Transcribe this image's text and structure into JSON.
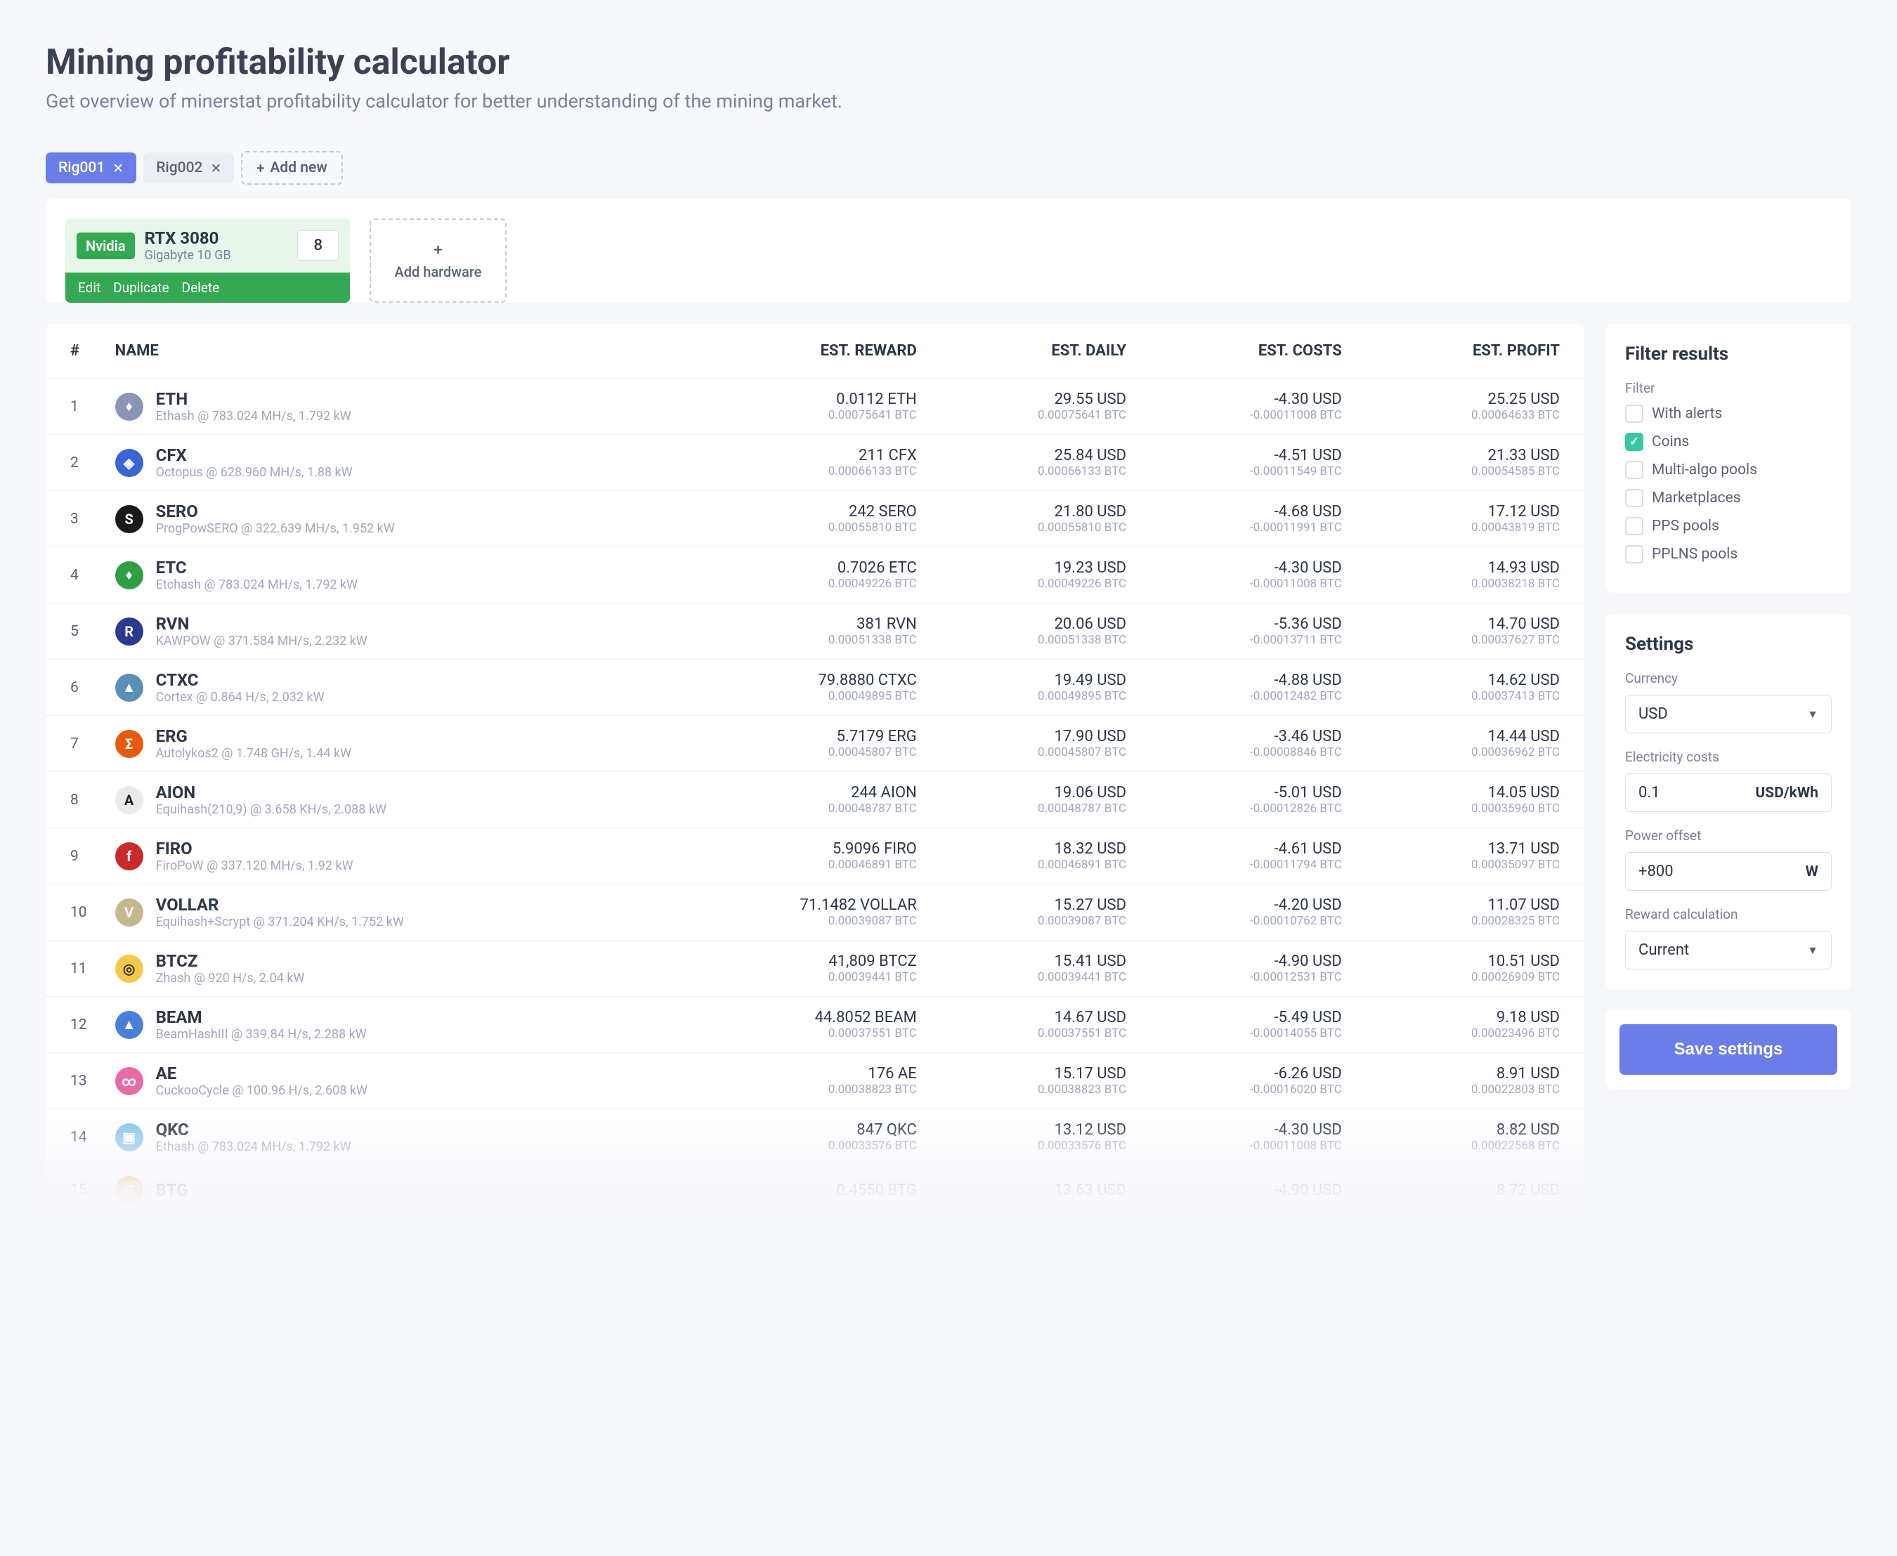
{
  "page": {
    "title": "Mining profitability calculator",
    "subtitle": "Get overview of minerstat profitability calculator for better understanding of the mining market."
  },
  "tabs": [
    {
      "label": "Rig001",
      "active": true
    },
    {
      "label": "Rig002",
      "active": false
    }
  ],
  "add_new_label": "Add new",
  "hardware": {
    "vendor": "Nvidia",
    "name": "RTX 3080",
    "sub": "Gigabyte 10 GB",
    "count": "8",
    "actions": {
      "edit": "Edit",
      "duplicate": "Duplicate",
      "delete": "Delete"
    }
  },
  "add_hardware_label": "Add hardware",
  "table": {
    "headers": {
      "idx": "#",
      "name": "NAME",
      "reward": "EST. REWARD",
      "daily": "EST. DAILY",
      "costs": "EST. COSTS",
      "profit": "EST. PROFIT"
    },
    "rows": [
      {
        "idx": "1",
        "sym": "ETH",
        "ic": "♦",
        "bg": "#8a94b6",
        "sub": "Ethash @ 783.024 MH/s, 1.792 kW",
        "reward": "0.0112 ETH",
        "reward_btc": "0.00075641 BTC",
        "daily": "29.55 USD",
        "daily_btc": "0.00075641 BTC",
        "costs": "-4.30 USD",
        "costs_btc": "-0.00011008 BTC",
        "profit": "25.25 USD",
        "profit_btc": "0.00064633 BTC"
      },
      {
        "idx": "2",
        "sym": "CFX",
        "ic": "◈",
        "bg": "#3864d4",
        "sub": "Octopus @ 628.960 MH/s, 1.88 kW",
        "reward": "211 CFX",
        "reward_btc": "0.00066133 BTC",
        "daily": "25.84 USD",
        "daily_btc": "0.00066133 BTC",
        "costs": "-4.51 USD",
        "costs_btc": "-0.00011549 BTC",
        "profit": "21.33 USD",
        "profit_btc": "0.00054585 BTC"
      },
      {
        "idx": "3",
        "sym": "SERO",
        "ic": "S",
        "bg": "#1a1a1a",
        "sub": "ProgPowSERO @ 322.639 MH/s, 1.952 kW",
        "reward": "242 SERO",
        "reward_btc": "0.00055810 BTC",
        "daily": "21.80 USD",
        "daily_btc": "0.00055810 BTC",
        "costs": "-4.68 USD",
        "costs_btc": "-0.00011991 BTC",
        "profit": "17.12 USD",
        "profit_btc": "0.00043819 BTC"
      },
      {
        "idx": "4",
        "sym": "ETC",
        "ic": "♦",
        "bg": "#2f9e44",
        "sub": "Etchash @ 783.024 MH/s, 1.792 kW",
        "reward": "0.7026 ETC",
        "reward_btc": "0.00049226 BTC",
        "daily": "19.23 USD",
        "daily_btc": "0.00049226 BTC",
        "costs": "-4.30 USD",
        "costs_btc": "-0.00011008 BTC",
        "profit": "14.93 USD",
        "profit_btc": "0.00038218 BTC"
      },
      {
        "idx": "5",
        "sym": "RVN",
        "ic": "R",
        "bg": "#2b3a8f",
        "sub": "KAWPOW @ 371.584 MH/s, 2.232 kW",
        "reward": "381 RVN",
        "reward_btc": "0.00051338 BTC",
        "daily": "20.06 USD",
        "daily_btc": "0.00051338 BTC",
        "costs": "-5.36 USD",
        "costs_btc": "-0.00013711 BTC",
        "profit": "14.70 USD",
        "profit_btc": "0.00037627 BTC"
      },
      {
        "idx": "6",
        "sym": "CTXC",
        "ic": "▲",
        "bg": "#5a8fb8",
        "sub": "Cortex @ 0.864 H/s, 2.032 kW",
        "reward": "79.8880 CTXC",
        "reward_btc": "0.00049895 BTC",
        "daily": "19.49 USD",
        "daily_btc": "0.00049895 BTC",
        "costs": "-4.88 USD",
        "costs_btc": "-0.00012482 BTC",
        "profit": "14.62 USD",
        "profit_btc": "0.00037413 BTC"
      },
      {
        "idx": "7",
        "sym": "ERG",
        "ic": "Σ",
        "bg": "#e8590c",
        "sub": "Autolykos2 @ 1.748 GH/s, 1.44 kW",
        "reward": "5.7179 ERG",
        "reward_btc": "0.00045807 BTC",
        "daily": "17.90 USD",
        "daily_btc": "0.00045807 BTC",
        "costs": "-3.46 USD",
        "costs_btc": "-0.00008846 BTC",
        "profit": "14.44 USD",
        "profit_btc": "0.00036962 BTC"
      },
      {
        "idx": "8",
        "sym": "AION",
        "ic": "A",
        "bg": "#eaeaea",
        "fg": "#222",
        "sub": "Equihash(210,9) @ 3.658 KH/s, 2.088 kW",
        "reward": "244 AION",
        "reward_btc": "0.00048787 BTC",
        "daily": "19.06 USD",
        "daily_btc": "0.00048787 BTC",
        "costs": "-5.01 USD",
        "costs_btc": "-0.00012826 BTC",
        "profit": "14.05 USD",
        "profit_btc": "0.00035960 BTC"
      },
      {
        "idx": "9",
        "sym": "FIRO",
        "ic": "f",
        "bg": "#c92a2a",
        "sub": "FiroPoW @ 337.120 MH/s, 1.92 kW",
        "reward": "5.9096 FIRO",
        "reward_btc": "0.00046891 BTC",
        "daily": "18.32 USD",
        "daily_btc": "0.00046891 BTC",
        "costs": "-4.61 USD",
        "costs_btc": "-0.00011794 BTC",
        "profit": "13.71 USD",
        "profit_btc": "0.00035097 BTC"
      },
      {
        "idx": "10",
        "sym": "VOLLAR",
        "ic": "V",
        "bg": "#c5b88e",
        "sub": "Equihash+Scrypt @ 371.204 KH/s, 1.752 kW",
        "reward": "71.1482 VOLLAR",
        "reward_btc": "0.00039087 BTC",
        "daily": "15.27 USD",
        "daily_btc": "0.00039087 BTC",
        "costs": "-4.20 USD",
        "costs_btc": "-0.00010762 BTC",
        "profit": "11.07 USD",
        "profit_btc": "0.00028325 BTC"
      },
      {
        "idx": "11",
        "sym": "BTCZ",
        "ic": "◎",
        "bg": "#f2c94c",
        "fg": "#333",
        "sub": "Zhash @ 920 H/s, 2.04 kW",
        "reward": "41,809 BTCZ",
        "reward_btc": "0.00039441 BTC",
        "daily": "15.41 USD",
        "daily_btc": "0.00039441 BTC",
        "costs": "-4.90 USD",
        "costs_btc": "-0.00012531 BTC",
        "profit": "10.51 USD",
        "profit_btc": "0.00026909 BTC"
      },
      {
        "idx": "12",
        "sym": "BEAM",
        "ic": "▲",
        "bg": "#4a7fd8",
        "sub": "BeamHashIII @ 339.84 H/s, 2.288 kW",
        "reward": "44.8052 BEAM",
        "reward_btc": "0.00037551 BTC",
        "daily": "14.67 USD",
        "daily_btc": "0.00037551 BTC",
        "costs": "-5.49 USD",
        "costs_btc": "-0.00014055 BTC",
        "profit": "9.18 USD",
        "profit_btc": "0.00023496 BTC"
      },
      {
        "idx": "13",
        "sym": "AE",
        "ic": "∞",
        "bg": "#e86aa6",
        "sub": "CuckooCycle @ 100.96 H/s, 2.608 kW",
        "reward": "176 AE",
        "reward_btc": "0.00038823 BTC",
        "daily": "15.17 USD",
        "daily_btc": "0.00038823 BTC",
        "costs": "-6.26 USD",
        "costs_btc": "-0.00016020 BTC",
        "profit": "8.91 USD",
        "profit_btc": "0.00022803 BTC"
      },
      {
        "idx": "14",
        "sym": "QKC",
        "ic": "▣",
        "bg": "#8ac4e8",
        "sub": "Ethash @ 783.024 MH/s, 1.792 kW",
        "reward": "847 QKC",
        "reward_btc": "0.00033576 BTC",
        "daily": "13.12 USD",
        "daily_btc": "0.00033576 BTC",
        "costs": "-4.30 USD",
        "costs_btc": "-0.00011008 BTC",
        "profit": "8.82 USD",
        "profit_btc": "0.00022568 BTC"
      },
      {
        "idx": "15",
        "sym": "BTG",
        "ic": "G",
        "bg": "#e8a33d",
        "sub": "",
        "reward": "0.4550 BTG",
        "reward_btc": "",
        "daily": "13.63 USD",
        "daily_btc": "",
        "costs": "-4.90 USD",
        "costs_btc": "",
        "profit": "8.72 USD",
        "profit_btc": ""
      }
    ]
  },
  "filter": {
    "title": "Filter results",
    "section": "Filter",
    "items": [
      {
        "label": "With alerts",
        "on": false
      },
      {
        "label": "Coins",
        "on": true
      },
      {
        "label": "Multi-algo pools",
        "on": false
      },
      {
        "label": "Marketplaces",
        "on": false
      },
      {
        "label": "PPS pools",
        "on": false
      },
      {
        "label": "PPLNS pools",
        "on": false
      }
    ]
  },
  "settings": {
    "title": "Settings",
    "currency_label": "Currency",
    "currency_value": "USD",
    "elec_label": "Electricity costs",
    "elec_value": "0.1",
    "elec_unit": "USD/kWh",
    "power_label": "Power offset",
    "power_value": "+800",
    "power_unit": "W",
    "reward_label": "Reward calculation",
    "reward_value": "Current",
    "save": "Save settings"
  }
}
